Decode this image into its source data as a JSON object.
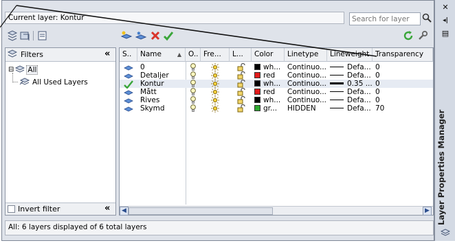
{
  "palette": {
    "panel_bg": "#dfe3ea",
    "selected_row": "#e6ebf3",
    "accent_blue": "#2d4f8f",
    "check_green": "#3aa63a",
    "delete_red": "#d9342b"
  },
  "titlebar": {
    "close_glyph": "✕",
    "autohide_glyph": "◂|",
    "properties_glyph": "▤",
    "vertical_title": "Layer Properties Manager"
  },
  "header": {
    "current_layer": "Current layer: Kontur",
    "search_placeholder": "Search for layer"
  },
  "toolbar": {
    "left_icons": [
      "new-property-filter-icon",
      "new-group-filter-icon",
      "layer-states-manager-icon"
    ],
    "mid_icons": [
      "new-layer-icon",
      "new-layer-vp-frozen-icon",
      "delete-layer-icon",
      "set-current-icon"
    ],
    "right_icons": [
      "refresh-icon",
      "settings-icon"
    ]
  },
  "filters": {
    "header": "Filters",
    "collapse_glyph": "«",
    "tree": [
      {
        "label": "All",
        "expander": "⊟"
      },
      {
        "label": "All Used Layers"
      }
    ],
    "invert_label": "Invert filter"
  },
  "columns": [
    "S..",
    "Name",
    "O..",
    "Fre...",
    "L...",
    "Color",
    "Linetype",
    "Lineweight",
    "Transparency"
  ],
  "layers": [
    {
      "status": "layer",
      "name": "0",
      "color_name": "wh...",
      "color_hex": "#000000",
      "linetype": "Continuo...",
      "lineweight": "Defa...",
      "thick": false,
      "transparency": "0",
      "current": false
    },
    {
      "status": "layer",
      "name": "Detaljer",
      "color_name": "red",
      "color_hex": "#e21b1b",
      "linetype": "Continuo...",
      "lineweight": "Defa...",
      "thick": false,
      "transparency": "0",
      "current": false
    },
    {
      "status": "current",
      "name": "Kontur",
      "color_name": "wh...",
      "color_hex": "#000000",
      "linetype": "Continuo...",
      "lineweight": "0.35 ...",
      "thick": true,
      "transparency": "0",
      "current": true
    },
    {
      "status": "layer",
      "name": "Mått",
      "color_name": "red",
      "color_hex": "#e21b1b",
      "linetype": "Continuo...",
      "lineweight": "Defa...",
      "thick": false,
      "transparency": "0",
      "current": false
    },
    {
      "status": "layer",
      "name": "Rives",
      "color_name": "wh...",
      "color_hex": "#000000",
      "linetype": "Continuo...",
      "lineweight": "Defa...",
      "thick": false,
      "transparency": "0",
      "current": false
    },
    {
      "status": "layer",
      "name": "Skymd",
      "color_name": "gr...",
      "color_hex": "#2fa82f",
      "linetype": "HIDDEN",
      "lineweight": "Defa...",
      "thick": false,
      "transparency": "70",
      "current": false
    }
  ],
  "status_bar": "All: 6 layers displayed of 6 total layers"
}
